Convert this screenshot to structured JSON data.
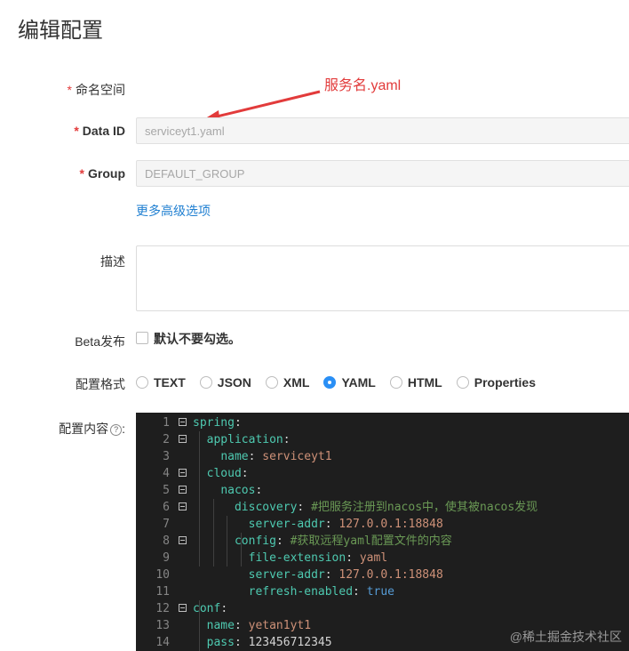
{
  "page": {
    "title": "编辑配置"
  },
  "annotation": {
    "text": "服务名.yaml",
    "color": "#e23b3b"
  },
  "form": {
    "namespace": {
      "label": "命名空间"
    },
    "data_id": {
      "label": "Data ID",
      "value": "serviceyt1.yaml"
    },
    "group": {
      "label": "Group",
      "value": "DEFAULT_GROUP"
    },
    "more_options": "更多高级选项",
    "description": {
      "label": "描述",
      "value": ""
    },
    "beta": {
      "label": "Beta发布",
      "checkbox_label": "默认不要勾选。",
      "checked": false
    },
    "format": {
      "label": "配置格式",
      "options": [
        "TEXT",
        "JSON",
        "XML",
        "YAML",
        "HTML",
        "Properties"
      ],
      "selected": "YAML"
    },
    "content": {
      "label": "配置内容",
      "help_icon": "question-circle-icon"
    }
  },
  "editor": {
    "lines": [
      {
        "n": "1",
        "fold": true,
        "tokens": [
          [
            "k",
            "spring"
          ],
          [
            "p",
            ":"
          ]
        ]
      },
      {
        "n": "2",
        "fold": true,
        "tokens": [
          [
            "p",
            "  "
          ],
          [
            "k",
            "application"
          ],
          [
            "p",
            ":"
          ]
        ]
      },
      {
        "n": "3",
        "fold": false,
        "tokens": [
          [
            "p",
            "    "
          ],
          [
            "k",
            "name"
          ],
          [
            "p",
            ": "
          ],
          [
            "v",
            "serviceyt1"
          ]
        ]
      },
      {
        "n": "4",
        "fold": true,
        "tokens": [
          [
            "p",
            "  "
          ],
          [
            "k",
            "cloud"
          ],
          [
            "p",
            ":"
          ]
        ]
      },
      {
        "n": "5",
        "fold": true,
        "tokens": [
          [
            "p",
            "    "
          ],
          [
            "k",
            "nacos"
          ],
          [
            "p",
            ":"
          ]
        ]
      },
      {
        "n": "6",
        "fold": true,
        "tokens": [
          [
            "p",
            "      "
          ],
          [
            "k",
            "discovery"
          ],
          [
            "p",
            ": "
          ],
          [
            "c",
            "#把服务注册到nacos中，使其被nacos发现"
          ]
        ]
      },
      {
        "n": "7",
        "fold": false,
        "tokens": [
          [
            "p",
            "        "
          ],
          [
            "k",
            "server-addr"
          ],
          [
            "p",
            ": "
          ],
          [
            "v",
            "127.0.0.1:18848"
          ]
        ]
      },
      {
        "n": "8",
        "fold": true,
        "tokens": [
          [
            "p",
            "      "
          ],
          [
            "k",
            "config"
          ],
          [
            "p",
            ": "
          ],
          [
            "c",
            "#获取远程yaml配置文件的内容"
          ]
        ]
      },
      {
        "n": "9",
        "fold": false,
        "tokens": [
          [
            "p",
            "        "
          ],
          [
            "k",
            "file-extension"
          ],
          [
            "p",
            ": "
          ],
          [
            "v",
            "yaml"
          ]
        ]
      },
      {
        "n": "10",
        "fold": false,
        "tokens": [
          [
            "p",
            "        "
          ],
          [
            "k",
            "server-addr"
          ],
          [
            "p",
            ": "
          ],
          [
            "v",
            "127.0.0.1:18848"
          ]
        ]
      },
      {
        "n": "11",
        "fold": false,
        "tokens": [
          [
            "p",
            "        "
          ],
          [
            "k",
            "refresh-enabled"
          ],
          [
            "p",
            ": "
          ],
          [
            "b",
            "true"
          ]
        ]
      },
      {
        "n": "12",
        "fold": true,
        "tokens": [
          [
            "k",
            "conf"
          ],
          [
            "p",
            ":"
          ]
        ]
      },
      {
        "n": "13",
        "fold": false,
        "tokens": [
          [
            "p",
            "  "
          ],
          [
            "k",
            "name"
          ],
          [
            "p",
            ": "
          ],
          [
            "v",
            "yetan1yt1"
          ]
        ]
      },
      {
        "n": "14",
        "fold": false,
        "tokens": [
          [
            "p",
            "  "
          ],
          [
            "k",
            "pass"
          ],
          [
            "p",
            ": "
          ],
          [
            "p",
            "123456712345"
          ]
        ]
      }
    ]
  },
  "watermark": "@稀土掘金技术社区"
}
